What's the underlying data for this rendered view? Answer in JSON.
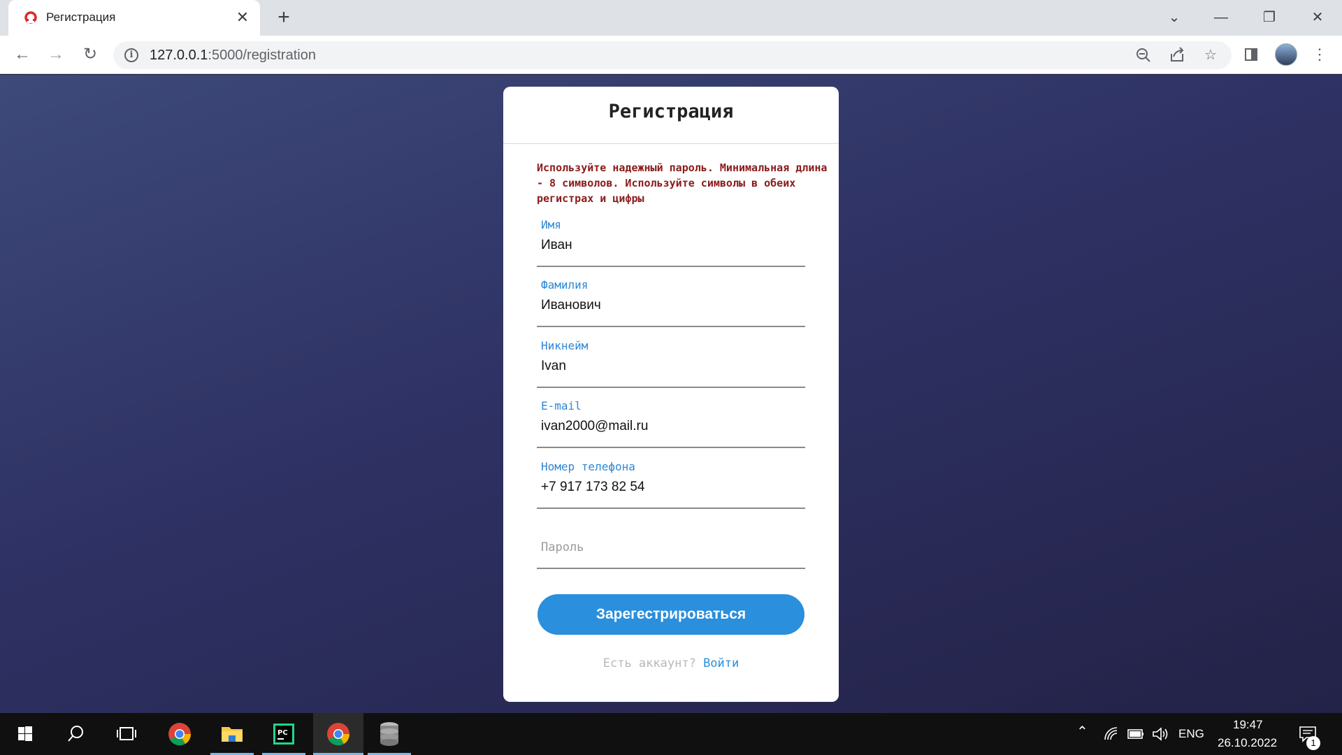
{
  "browser": {
    "tab_title": "Регистрация",
    "tab_close": "✕",
    "new_tab": "+",
    "url_host": "127.0.0.1",
    "url_path": ":5000/registration"
  },
  "page": {
    "title": "Регистрация",
    "hint": "Используйте надежный пароль. Минимальная длина - 8 символов. Используйте символы в обеих регистрах и цифры",
    "fields": [
      {
        "label": "Имя",
        "value": "Иван"
      },
      {
        "label": "Фамилия",
        "value": "Иванович"
      },
      {
        "label": "Никнейм",
        "value": "Ivan"
      },
      {
        "label": "E-mail",
        "value": "ivan2000@mail.ru"
      },
      {
        "label": "Номер телефона",
        "value": "+7 917 173 82 54"
      }
    ],
    "password_placeholder": "Пароль",
    "submit_label": "Зарегестрироваться",
    "login_prompt": "Есть аккаунт?",
    "login_link": "Войти",
    "accent_color": "#2a8fdc",
    "hint_color": "#8b1b1b"
  },
  "taskbar": {
    "language": "ENG",
    "time": "19:47",
    "date": "26.10.2022",
    "notification_count": "1"
  }
}
